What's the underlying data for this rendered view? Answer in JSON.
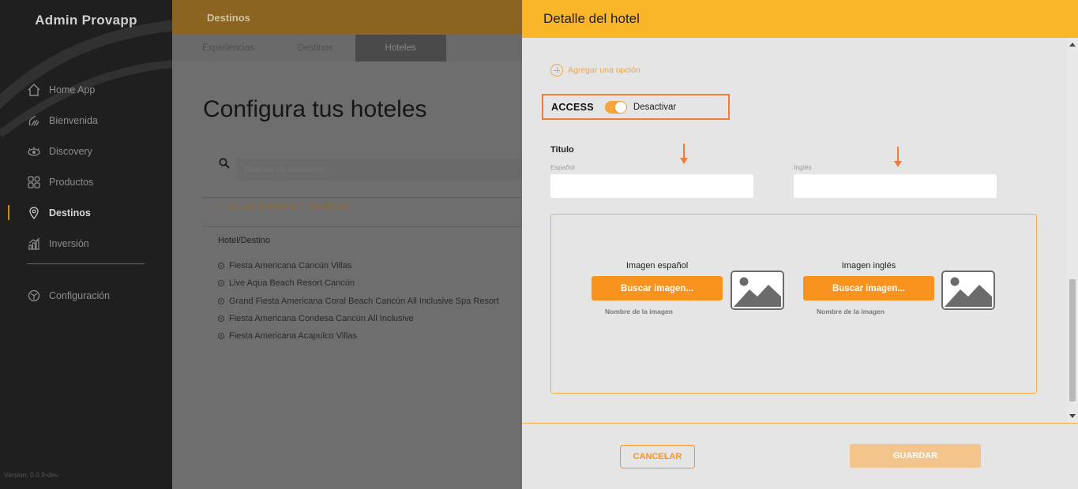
{
  "sidebar": {
    "brand": "Admin Provapp",
    "items": [
      {
        "label": "Home App",
        "icon": "home-icon"
      },
      {
        "label": "Bienvenida",
        "icon": "welcome-icon"
      },
      {
        "label": "Discovery",
        "icon": "eye-icon"
      },
      {
        "label": "Productos",
        "icon": "grid-icon"
      },
      {
        "label": "Destinos",
        "icon": "location-pin-icon",
        "active": true
      },
      {
        "label": "Inversión",
        "icon": "bar-chart-icon"
      }
    ],
    "settings": {
      "label": "Configuración",
      "icon": "settings-icon"
    },
    "version": "Version: 0.0.9-dev"
  },
  "main": {
    "section_title": "Destinos",
    "tabs": [
      "Experiencias",
      "Destinos",
      "Hoteles"
    ],
    "active_tab": "Hoteles",
    "page_title": "Configura tus hoteles",
    "search_placeholder": "Buscas un elemento",
    "list_title": "Lista de Hoteles / Destinos",
    "column_header": "Hotel/Destino",
    "hotels": [
      "Fiesta Americana Cancún Villas",
      "Live Aqua Beach Resort Cancún",
      "Grand Fiesta Americana Coral Beach Cancún All Inclusive Spa Resort",
      "Fiesta Americana Condesa Cancún All Inclusive",
      "Fiesta Americana Acapulco Villas"
    ]
  },
  "panel": {
    "title": "Detalle del hotel",
    "add_option": "Agregar una opción",
    "access_label": "ACCESS",
    "toggle_label": "Desactivar",
    "toggle_on": true,
    "titulo_label": "Titulo",
    "field_es_label": "Español",
    "field_en_label": "Inglés",
    "field_es_value": "",
    "field_en_value": "",
    "image_es_title": "Imagen español",
    "image_en_title": "Imagen inglés",
    "search_image_label": "Buscar imagen...",
    "image_name_label": "Nombre de la imagen",
    "cancel_label": "CANCELAR",
    "save_label": "GUARDAR"
  },
  "colors": {
    "accent": "#fab529",
    "orange_button": "#f7931e",
    "highlight": "#ef7e3c"
  }
}
